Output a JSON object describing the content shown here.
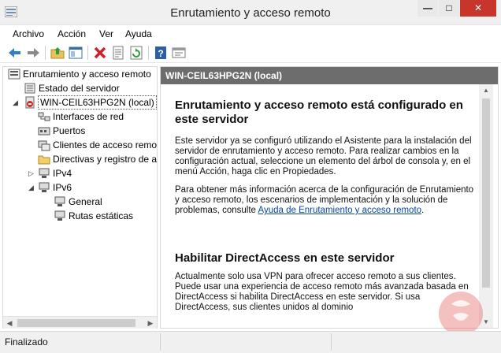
{
  "window": {
    "title": "Enrutamiento y acceso remoto",
    "minimize": "—",
    "maximize": "□",
    "close": "✕"
  },
  "menu": {
    "items": [
      "Archivo",
      "Acción",
      "Ver",
      "Ayuda"
    ]
  },
  "toolbar": {
    "icons": [
      "back-arrow-icon",
      "forward-arrow-icon",
      "up-folder-icon",
      "show-hide-tree-icon",
      "delete-icon",
      "properties-icon",
      "refresh-icon",
      "help-icon",
      "console-icon"
    ]
  },
  "tree": {
    "items": [
      {
        "label": "Enrutamiento y acceso remoto",
        "icon": "rras-root-icon"
      },
      {
        "label": "Estado del servidor",
        "icon": "server-status-icon"
      },
      {
        "label": "WIN-CEIL63HPG2N (local)",
        "icon": "server-stopped-icon"
      },
      {
        "label": "Interfaces de red",
        "icon": "interfaces-icon"
      },
      {
        "label": "Puertos",
        "icon": "ports-icon"
      },
      {
        "label": "Clientes de acceso remo",
        "icon": "clients-icon"
      },
      {
        "label": "Directivas y registro de a",
        "icon": "policies-folder-icon"
      },
      {
        "label": "IPv4",
        "icon": "ipv4-icon"
      },
      {
        "label": "IPv6",
        "icon": "ipv6-icon"
      },
      {
        "label": "General",
        "icon": "general-icon"
      },
      {
        "label": "Rutas estáticas",
        "icon": "static-routes-icon"
      }
    ]
  },
  "right": {
    "header": "WIN-CEIL63HPG2N (local)",
    "heading1": "Enrutamiento y acceso remoto está configurado en este servidor",
    "para1": "Este servidor ya se configuró utilizando el Asistente para la instalación del servidor de enrutamiento y acceso remoto. Para realizar cambios en la configuración actual, seleccione un elemento del árbol de consola y, en el menú Acción, haga clic en Propiedades.",
    "para2_prefix": "Para obtener más información acerca de la configuración de Enrutamiento y acceso remoto, los escenarios de implementación y la solución de problemas, consulte ",
    "para2_link": "Ayuda de Enrutamiento y acceso remoto",
    "para2_suffix": ".",
    "heading2": "Habilitar DirectAccess en este servidor",
    "para3": "Actualmente solo usa VPN para ofrecer acceso remoto a sus clientes. Puede usar una experiencia de acceso remoto más avanzada basada en DirectAccess si habilita DirectAccess en este servidor. Si usa DirectAccess, sus clientes unidos al dominio"
  },
  "status": {
    "text": "Finalizado"
  },
  "colors": {
    "header_bg": "#6d6d6d",
    "close_bg": "#c7352d",
    "link": "#0645ad"
  }
}
